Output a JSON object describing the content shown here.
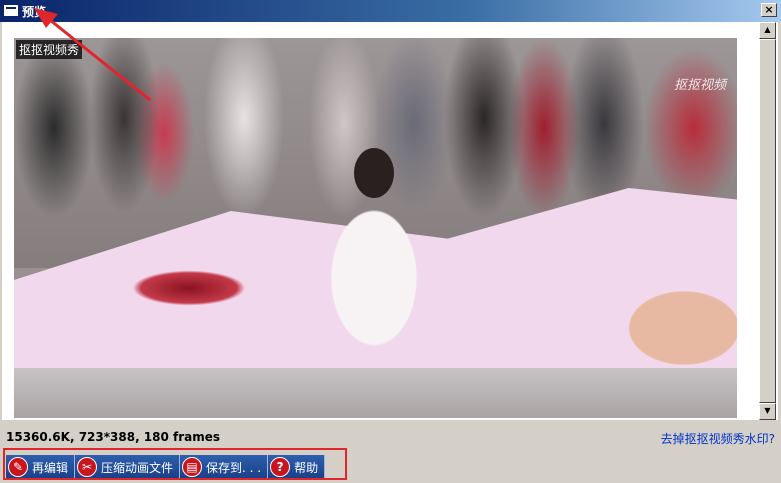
{
  "window": {
    "title": "预览",
    "close_glyph": "×"
  },
  "preview": {
    "watermark_top": "抠抠视频秀",
    "watermark_corner": "抠抠视频"
  },
  "info": {
    "summary": "15360.6K, 723*388, 180 frames",
    "remove_watermark_link": "去掉抠抠视频秀水印?"
  },
  "toolbar": {
    "buttons": [
      {
        "label": "再编辑",
        "icon": "wrench-icon",
        "glyph": "✎"
      },
      {
        "label": "压缩动画文件",
        "icon": "scissors-icon",
        "glyph": "✂"
      },
      {
        "label": "保存到. . .",
        "icon": "save-icon",
        "glyph": "▤"
      },
      {
        "label": "帮助",
        "icon": "help-icon",
        "glyph": "?"
      }
    ]
  },
  "colors": {
    "annotation_red": "#e0262b",
    "title_blue": "#0a246a",
    "button_blue": "#2d5fae"
  }
}
